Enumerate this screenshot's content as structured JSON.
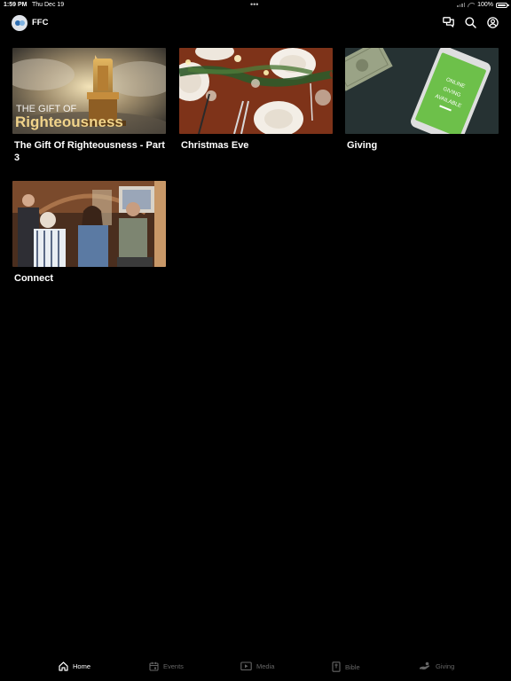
{
  "status": {
    "time": "1:59 PM",
    "date": "Thu Dec 19",
    "dots": "•••",
    "battery": "100%"
  },
  "header": {
    "title": "FFC",
    "icons": [
      "chat-icon",
      "search-icon",
      "account-icon"
    ]
  },
  "cards": [
    {
      "title": "The Gift Of Righteousness - Part 3",
      "thumb_line1": "THE GIFT OF",
      "thumb_line2": "Righteousness"
    },
    {
      "title": "Christmas Eve"
    },
    {
      "title": "Giving",
      "thumb_lines": [
        "ONLINE",
        "GIVING",
        "AVAILABLE"
      ]
    },
    {
      "title": "Connect"
    }
  ],
  "tabs": [
    {
      "label": "Home",
      "icon": "home-icon",
      "active": true
    },
    {
      "label": "Events",
      "icon": "calendar-icon",
      "active": false
    },
    {
      "label": "Media",
      "icon": "play-icon",
      "active": false
    },
    {
      "label": "Bible",
      "icon": "bible-icon",
      "active": false
    },
    {
      "label": "Giving",
      "icon": "giving-icon",
      "active": false
    }
  ],
  "colors": {
    "background": "#000000",
    "text": "#ffffff",
    "tab_inactive": "#666666",
    "giving_screen": "#6dc04a"
  }
}
